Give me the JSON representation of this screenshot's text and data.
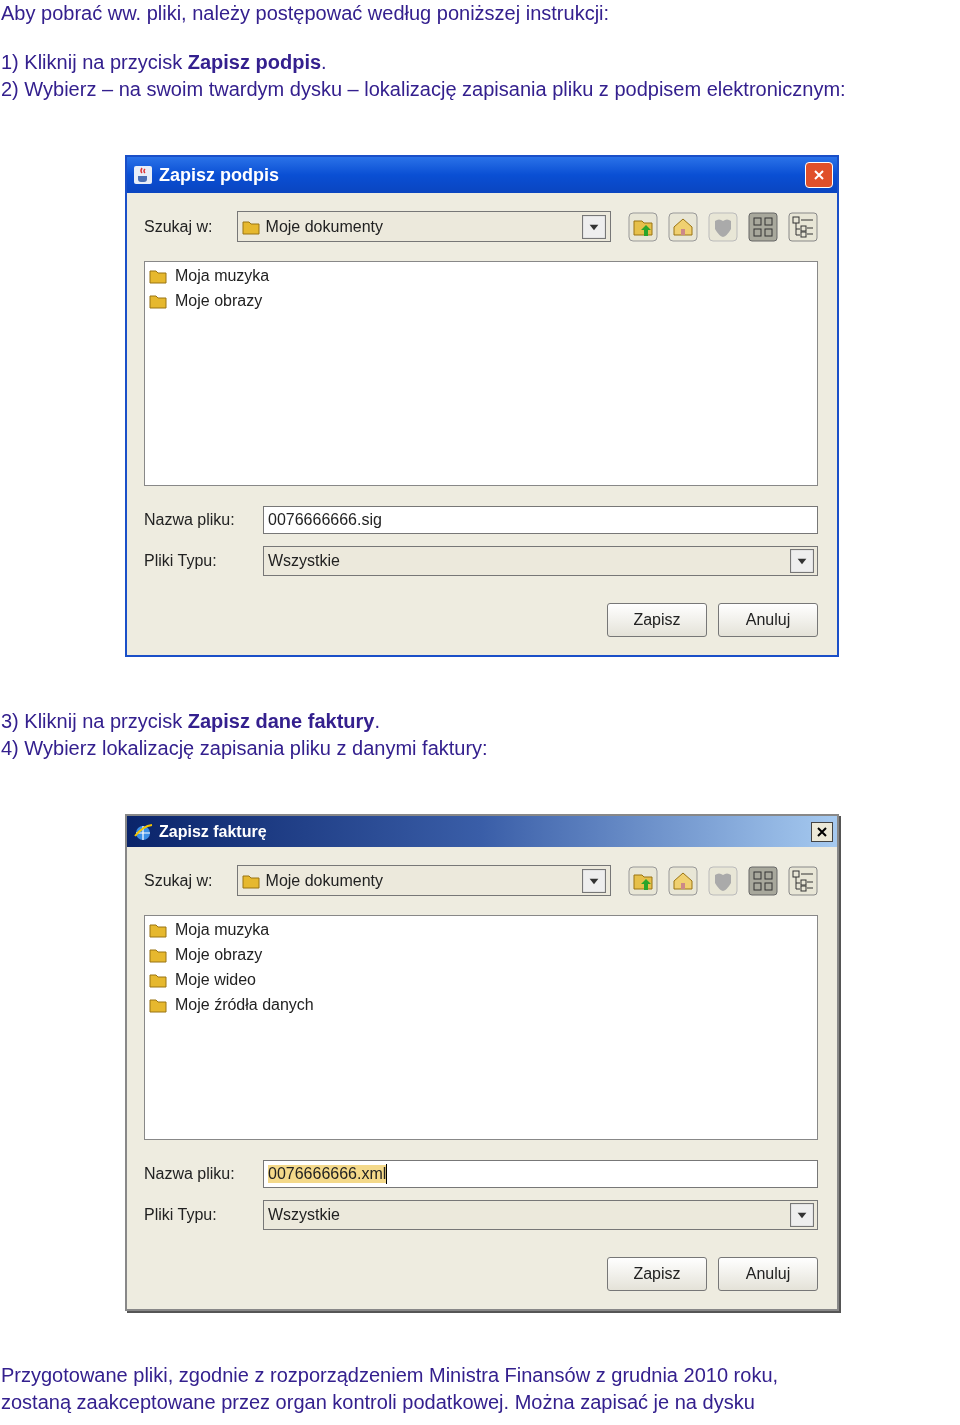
{
  "blocks": [
    {
      "kind": "paragraph",
      "lines": [
        "Aby pobrać ww. pliki, należy postępować według poniższej instrukcji:"
      ]
    },
    {
      "kind": "paragraph",
      "lines": [
        "1) Kliknij na przycisk **Zapisz podpis**.",
        "2) Wybierz – na swoim twardym dysku – lokalizację zapisania pliku z podpisem elektronicznym:"
      ]
    },
    {
      "kind": "xp_dialog",
      "title": "Zapisz podpis",
      "look_in_label": "Szukaj w:",
      "look_in_value": "Moje dokumenty",
      "files": [
        "Moja muzyka",
        "Moje obrazy"
      ],
      "filename_label": "Nazwa pliku:",
      "filename_value": "0076666666.sig",
      "filename_selected": false,
      "type_label": "Pliki Typu:",
      "type_value": "Wszystkie",
      "buttons": [
        "Zapisz",
        "Anuluj"
      ]
    },
    {
      "kind": "paragraph",
      "lines": [
        "3) Kliknij na przycisk **Zapisz dane faktury**.",
        "4) Wybierz lokalizację zapisania pliku z danymi faktury:"
      ]
    },
    {
      "kind": "classic_dialog",
      "title": "Zapisz fakturę",
      "look_in_label": "Szukaj w:",
      "look_in_value": "Moje dokumenty",
      "files": [
        "Moja muzyka",
        "Moje obrazy",
        "Moje wideo",
        "Moje źródła danych"
      ],
      "filename_label": "Nazwa pliku:",
      "filename_value": "0076666666.xml",
      "filename_selected": true,
      "type_label": "Pliki Typu:",
      "type_value": "Wszystkie",
      "buttons": [
        "Zapisz",
        "Anuluj"
      ]
    },
    {
      "kind": "paragraph",
      "lines": [
        "Przygotowane pliki, zgodnie z rozporządzeniem Ministra Finansów z grudnia 2010 roku,",
        "zostaną zaakceptowane przez organ kontroli podatkowej. Można zapisać je na dysku"
      ]
    }
  ]
}
